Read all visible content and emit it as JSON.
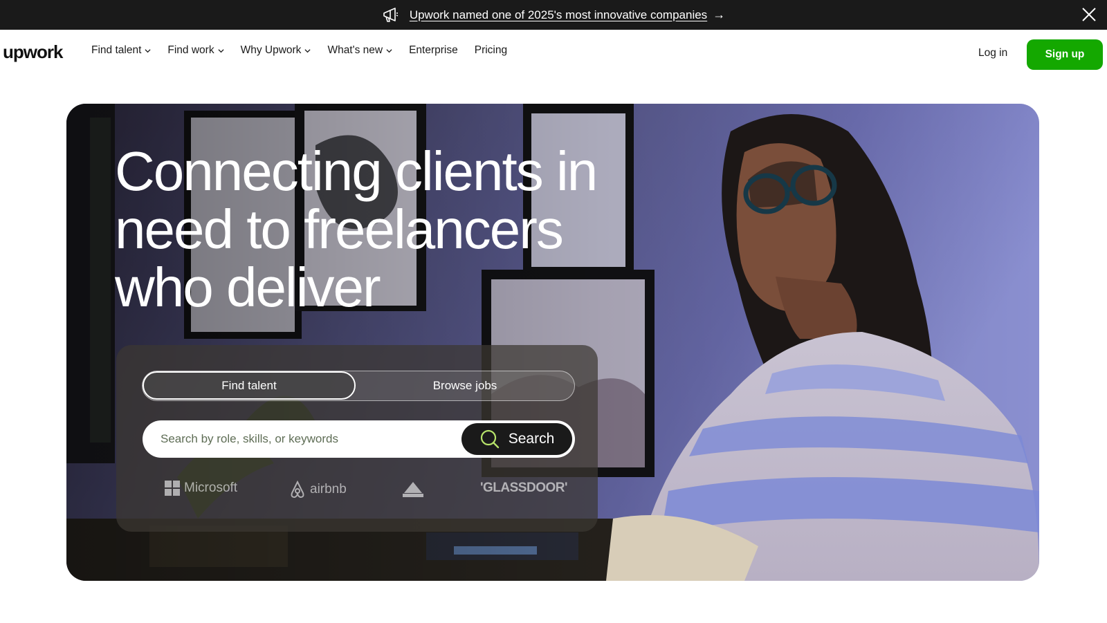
{
  "announcement": {
    "text": "Upwork named one of 2025's most innovative companies",
    "arrow": "→",
    "icon": "megaphone-icon",
    "close_icon": "close-icon"
  },
  "brand": {
    "logo_text": "upwork",
    "accent_color": "#14a800"
  },
  "nav": {
    "items": [
      {
        "label": "Find talent",
        "has_dropdown": true
      },
      {
        "label": "Find work",
        "has_dropdown": true
      },
      {
        "label": "Why Upwork",
        "has_dropdown": true
      },
      {
        "label": "What's new",
        "has_dropdown": true
      },
      {
        "label": "Enterprise",
        "has_dropdown": false
      },
      {
        "label": "Pricing",
        "has_dropdown": false
      }
    ],
    "login_label": "Log in",
    "signup_label": "Sign up"
  },
  "hero": {
    "headline": "Connecting clients in need to freelancers who deliver",
    "tabs": [
      {
        "label": "Find talent",
        "active": true
      },
      {
        "label": "Browse jobs",
        "active": false
      }
    ],
    "search": {
      "placeholder": "Search by role, skills, or keywords",
      "value": "",
      "button_label": "Search"
    },
    "trusted_by": [
      {
        "name": "Microsoft",
        "icon": "microsoft-logo-icon"
      },
      {
        "name": "airbnb",
        "icon": "airbnb-logo-icon"
      },
      {
        "name": "Bissell",
        "icon": "bissell-logo-icon"
      },
      {
        "name": "'GLASSDOOR'",
        "icon": "glassdoor-logo-icon"
      }
    ]
  }
}
